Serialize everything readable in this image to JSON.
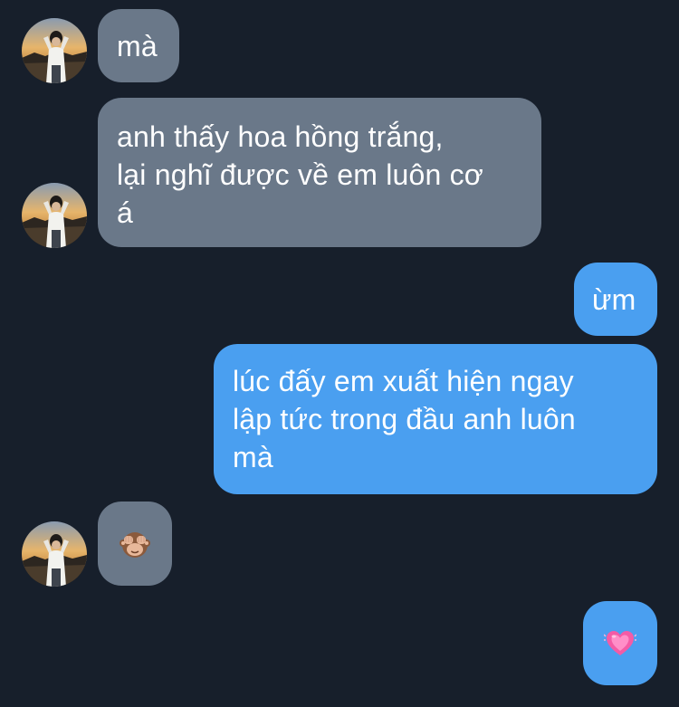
{
  "conversation": {
    "messages": [
      {
        "side": "incoming",
        "text": "mà"
      },
      {
        "side": "incoming",
        "text": "anh thấy hoa hồng trắng, lại nghĩ được về em luôn cơ á",
        "lines": [
          "anh thấy hoa hồng trắng,",
          "lại nghĩ được về em luôn cơ",
          "á"
        ]
      },
      {
        "side": "outgoing",
        "text": "ừm"
      },
      {
        "side": "outgoing",
        "text": "lúc đấy em xuất hiện ngay lập tức trong đầu anh luôn mà",
        "lines": [
          "lúc đấy em xuất hiện ngay",
          "lập tức trong đầu anh luôn",
          "mà"
        ]
      },
      {
        "side": "incoming",
        "text": "🙈",
        "type": "emoji",
        "icon": "see-no-evil-monkey-icon"
      },
      {
        "side": "outgoing",
        "text": "💓",
        "type": "emoji",
        "icon": "pink-heart-icon"
      }
    ]
  },
  "colors": {
    "background": "#171f2b",
    "incoming_bubble": "#6a7889",
    "outgoing_bubble": "#4a9ff0",
    "text": "#ffffff"
  }
}
